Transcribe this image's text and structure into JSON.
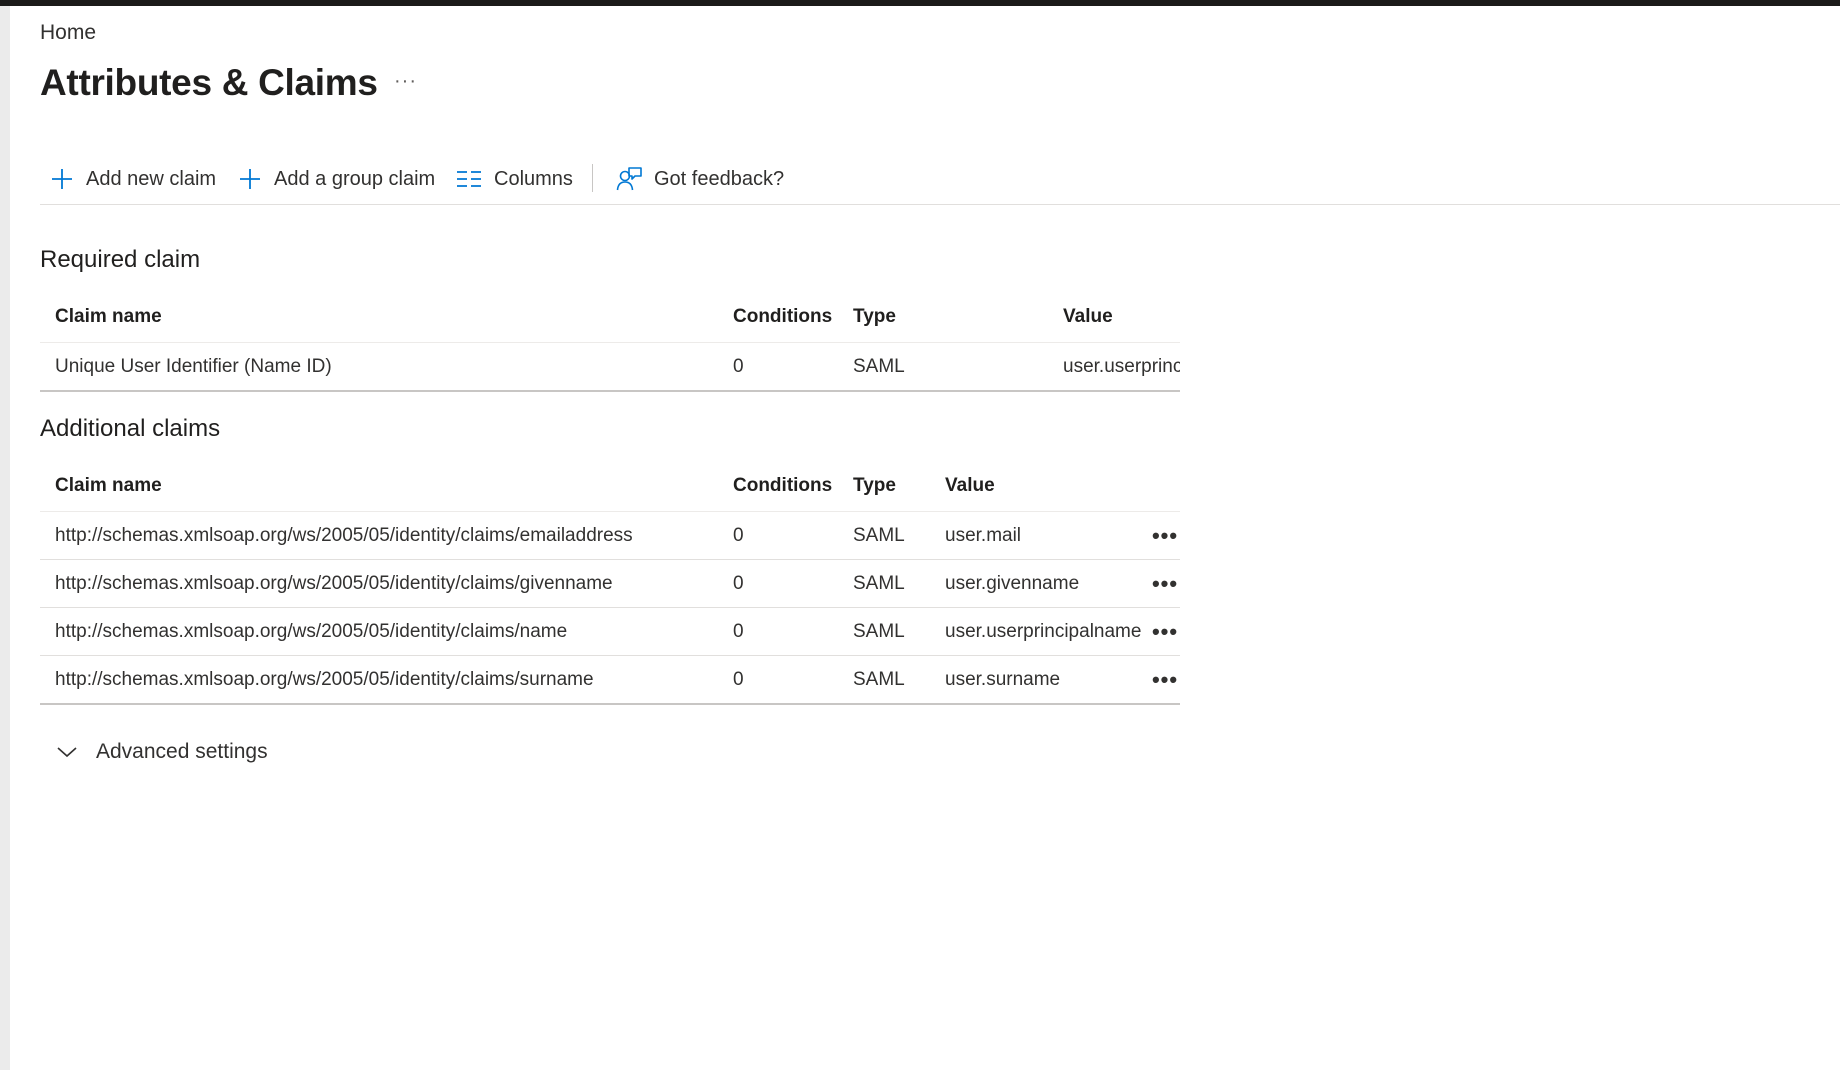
{
  "breadcrumb": {
    "home": "Home"
  },
  "header": {
    "title": "Attributes & Claims",
    "more": "···"
  },
  "toolbar": {
    "add_new_claim": "Add new claim",
    "add_group_claim": "Add a group claim",
    "columns": "Columns",
    "feedback": "Got feedback?"
  },
  "required": {
    "title": "Required claim",
    "columns": {
      "name": "Claim name",
      "conditions": "Conditions",
      "type": "Type",
      "value": "Value"
    },
    "rows": [
      {
        "name": "Unique User Identifier (Name ID)",
        "conditions": "0",
        "type": "SAML",
        "value": "user.userprinc"
      }
    ]
  },
  "additional": {
    "title": "Additional claims",
    "columns": {
      "name": "Claim name",
      "conditions": "Conditions",
      "type": "Type",
      "value": "Value"
    },
    "rows": [
      {
        "name": "http://schemas.xmlsoap.org/ws/2005/05/identity/claims/emailaddress",
        "conditions": "0",
        "type": "SAML",
        "value": "user.mail",
        "more": "•••"
      },
      {
        "name": "http://schemas.xmlsoap.org/ws/2005/05/identity/claims/givenname",
        "conditions": "0",
        "type": "SAML",
        "value": "user.givenname",
        "more": "•••"
      },
      {
        "name": "http://schemas.xmlsoap.org/ws/2005/05/identity/claims/name",
        "conditions": "0",
        "type": "SAML",
        "value": "user.userprincipalname",
        "more": "•••"
      },
      {
        "name": "http://schemas.xmlsoap.org/ws/2005/05/identity/claims/surname",
        "conditions": "0",
        "type": "SAML",
        "value": "user.surname",
        "more": "•••"
      }
    ]
  },
  "advanced": {
    "label": "Advanced settings"
  },
  "icons": {
    "add": "plus-icon",
    "columns": "columns-icon",
    "feedback": "feedback-icon",
    "chevron": "chevron-down-icon"
  },
  "colors": {
    "accent": "#0078d4",
    "topbar": "#1b1a19",
    "rail": "#ebebeb"
  }
}
